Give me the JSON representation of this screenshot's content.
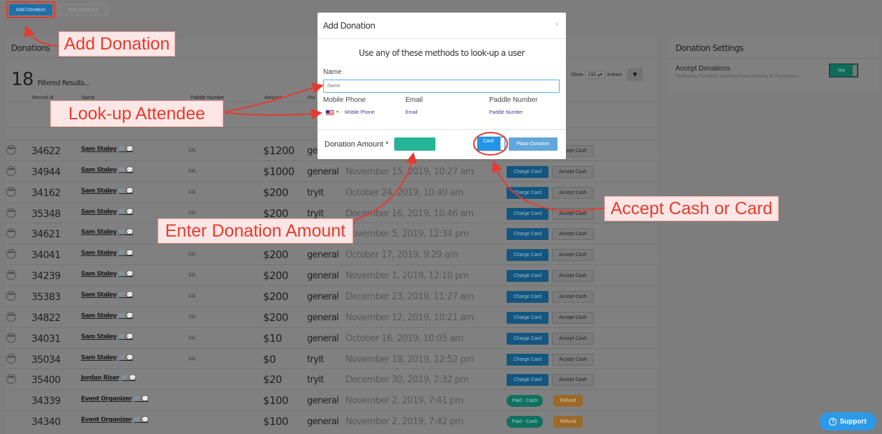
{
  "top": {
    "add_label": "Add Donation",
    "bulk_label": "Bulk Actions ▾"
  },
  "panel": {
    "title": "Donations",
    "filtered_count": "18",
    "filtered_label": "Filtered Results...",
    "show_label": "Show",
    "show_value": "100 ▴▾",
    "entries_label": "entries"
  },
  "columns": [
    "Record Id",
    "Name",
    "Paddle Number",
    "Amount",
    "Pur"
  ],
  "rows": [
    {
      "id": "34622",
      "name": "Sam Staley",
      "paddle": "111",
      "amount": "$1200",
      "purpose": "general",
      "date": "",
      "status": "pending"
    },
    {
      "id": "34944",
      "name": "Sam Staley",
      "paddle": "111",
      "amount": "$1000",
      "purpose": "general",
      "date": "November 15, 2019, 10:27 am",
      "status": "pending"
    },
    {
      "id": "34162",
      "name": "Sam Staley",
      "paddle": "111",
      "amount": "$200",
      "purpose": "tryit",
      "date": "October 24, 2019, 10:40 am",
      "status": "pending"
    },
    {
      "id": "35348",
      "name": "Sam Staley",
      "paddle": "111",
      "amount": "$200",
      "purpose": "tryit",
      "date": "December 16, 2019, 10:46 am",
      "status": "pending"
    },
    {
      "id": "34621",
      "name": "Sam Staley",
      "paddle": "",
      "amount": "",
      "purpose": "",
      "date": "November 5, 2019, 12:34 pm",
      "status": "pending"
    },
    {
      "id": "34041",
      "name": "Sam Staley",
      "paddle": "111",
      "amount": "$200",
      "purpose": "general",
      "date": "October 17, 2019, 9:29 am",
      "status": "pending"
    },
    {
      "id": "34239",
      "name": "Sam Staley",
      "paddle": "111",
      "amount": "$200",
      "purpose": "general",
      "date": "November 1, 2019, 12:10 pm",
      "status": "pending"
    },
    {
      "id": "35383",
      "name": "Sam Staley",
      "paddle": "111",
      "amount": "$200",
      "purpose": "general",
      "date": "December 23, 2019, 11:27 am",
      "status": "pending"
    },
    {
      "id": "34822",
      "name": "Sam Staley",
      "paddle": "111",
      "amount": "$200",
      "purpose": "general",
      "date": "November 12, 2019, 10:21 am",
      "status": "pending"
    },
    {
      "id": "34031",
      "name": "Sam Staley",
      "paddle": "111",
      "amount": "$10",
      "purpose": "general",
      "date": "October 16, 2019, 10:05 am",
      "status": "pending"
    },
    {
      "id": "35034",
      "name": "Sam Staley",
      "paddle": "111",
      "amount": "$0",
      "purpose": "tryit",
      "date": "November 18, 2019, 12:52 pm",
      "status": "pending"
    },
    {
      "id": "35400",
      "name": "Jordan Riser",
      "paddle": "-",
      "amount": "$20",
      "purpose": "tryit",
      "date": "December 30, 2019, 2:32 pm",
      "status": "pending"
    },
    {
      "id": "34339",
      "name": "Event Organizer",
      "paddle": "-",
      "amount": "$100",
      "purpose": "general",
      "date": "November 2, 2019, 7:41 pm",
      "status": "paid"
    },
    {
      "id": "34340",
      "name": "Event Organizer",
      "paddle": "-",
      "amount": "$100",
      "purpose": "general",
      "date": "November 2, 2019, 7:42 pm",
      "status": "paid"
    }
  ],
  "row_actions": {
    "charge": "Charge Card",
    "cash": "Accept Cash",
    "paid": "Paid - Cash",
    "refund": "Refund"
  },
  "settings": {
    "title": "Donation Settings",
    "accept_label": "Accept Donations",
    "accept_sub": "For Bidding, Donations, and Fixed Items including $0 Transactions",
    "toggle": "Yes"
  },
  "modal": {
    "title": "Add Donation",
    "close": "×",
    "subtitle": "Use any of these methods to look-up a user",
    "name_label": "Name",
    "name_placeholder": "Name",
    "phone_label": "Mobile Phone",
    "email_label": "Email",
    "paddle_label": "Paddle Number",
    "phone_placeholder": "Mobile Phone",
    "email_placeholder": "Email",
    "paddle_placeholder": "Paddle Number",
    "amount_label": "Donation Amount *",
    "card_label": "Card",
    "place_label": "Place Donation"
  },
  "callouts": {
    "add": "Add Donation",
    "lookup": "Look-up Attendee",
    "amount": "Enter Donation Amount",
    "cash_card": "Accept Cash or Card"
  },
  "support": "Support",
  "colors": {
    "annotation": "#e53a2f",
    "primary": "#2196e8",
    "teal": "#26b497"
  }
}
